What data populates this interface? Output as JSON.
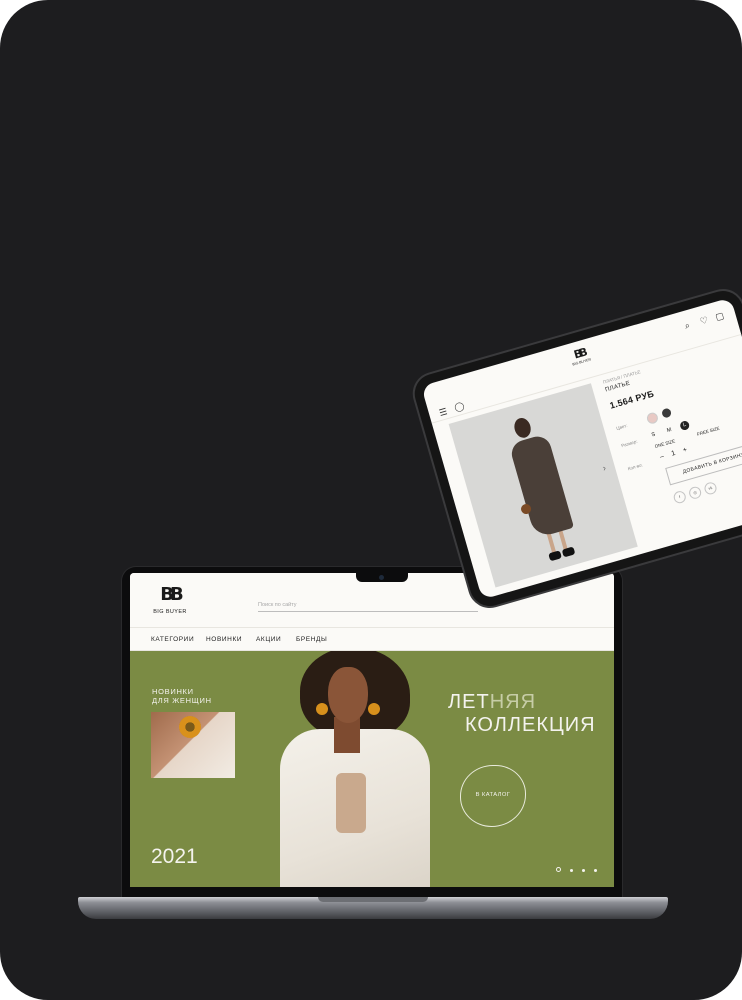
{
  "laptop": {
    "logo_mark": "BB",
    "logo_text": "BIG BUYER",
    "search_placeholder": "Поиск по сайту",
    "nav": [
      "КАТЕГОРИИ",
      "НОВИНКИ",
      "АКЦИИ",
      "БРЕНДЫ"
    ],
    "hero": {
      "subtitle": "НОВИНКИ\nДЛЯ ЖЕНЩИН",
      "title_line1_a": "ЛЕТ",
      "title_line1_b": "НЯЯ",
      "title_line2": "КОЛЛЕКЦИЯ",
      "cta": "В КАТАЛОГ",
      "year": "2021",
      "slides": 4,
      "active_slide": 1,
      "bg_color": "#7b8b44"
    }
  },
  "tablet": {
    "logo_mark": "BB",
    "logo_text": "BIG BUYER",
    "breadcrumb": "ПЛАТЬЯ / ПЛАТЬЕ",
    "product_name": "ПЛАТЬЕ",
    "price": "1.564 РУБ",
    "color_label": "Цвет:",
    "colors": [
      "#e8c9c4",
      "#3a3a3a"
    ],
    "size_label": "Размер:",
    "sizes": [
      "S",
      "M",
      "L"
    ],
    "selected_size": "L",
    "sizes_extra": [
      "ONE SIZE",
      "FREE SIZE"
    ],
    "qty_label": "Кол-во:",
    "qty": "1",
    "qty_minus": "–",
    "qty_plus": "+",
    "add_to_cart": "ДОБАВИТЬ В КОРЗИНУ",
    "socials": [
      "f",
      "◎",
      "vk"
    ]
  }
}
